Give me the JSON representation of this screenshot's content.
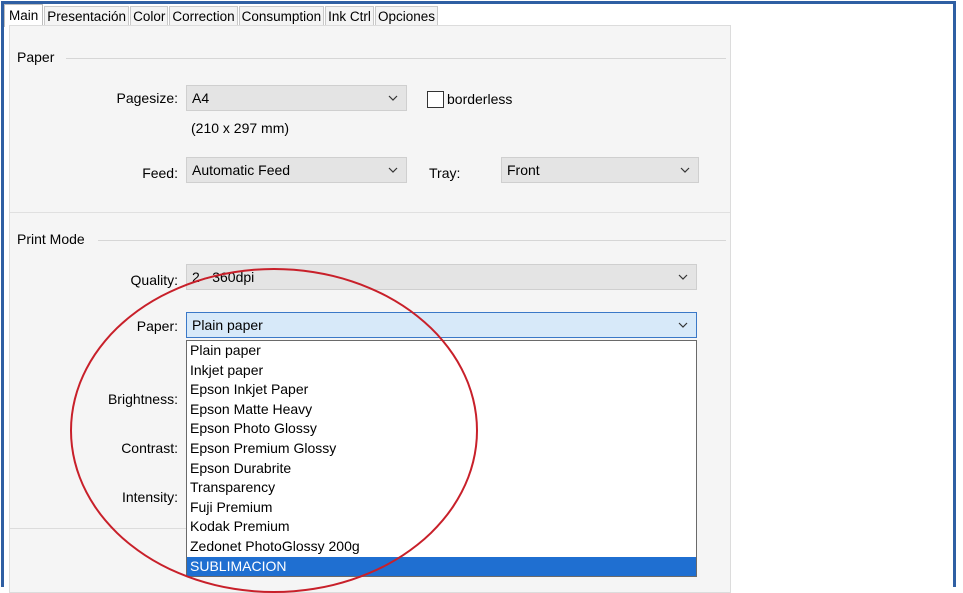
{
  "tabs": [
    "Main",
    "Presentación",
    "Color",
    "Correction",
    "Consumption",
    "Ink Ctrl",
    "Opciones"
  ],
  "paper_group": {
    "title": "Paper",
    "pagesize_label": "Pagesize:",
    "pagesize_value": "A4",
    "pagesize_dims": "(210 x 297 mm)",
    "borderless_label": "borderless",
    "feed_label": "Feed:",
    "feed_value": "Automatic Feed",
    "tray_label": "Tray:",
    "tray_value": "Front"
  },
  "print_mode_group": {
    "title": "Print Mode",
    "quality_label": "Quality:",
    "quality_value": "2 - 360dpi",
    "paper_label": "Paper:",
    "paper_value": "Plain paper",
    "brightness_label": "Brightness:",
    "contrast_label": "Contrast:",
    "intensity_label": "Intensity:"
  },
  "paper_options": [
    "Plain paper",
    "Inkjet paper",
    "Epson Inkjet Paper",
    "Epson Matte Heavy",
    "Epson Photo Glossy",
    "Epson Premium Glossy",
    "Epson Durabrite",
    "Transparency",
    "Fuji Premium",
    "Kodak Premium",
    "Zedonet PhotoGlossy 200g",
    "SUBLIMACION"
  ],
  "selected_option": "SUBLIMACION",
  "colors": {
    "frame_border": "#2f5fa3",
    "highlight": "#1f6fd1",
    "annotation_circle": "#c8202a",
    "focused_combo": "#d7e9f9"
  },
  "icons": {
    "combo_arrow": "chevron-down-icon"
  }
}
